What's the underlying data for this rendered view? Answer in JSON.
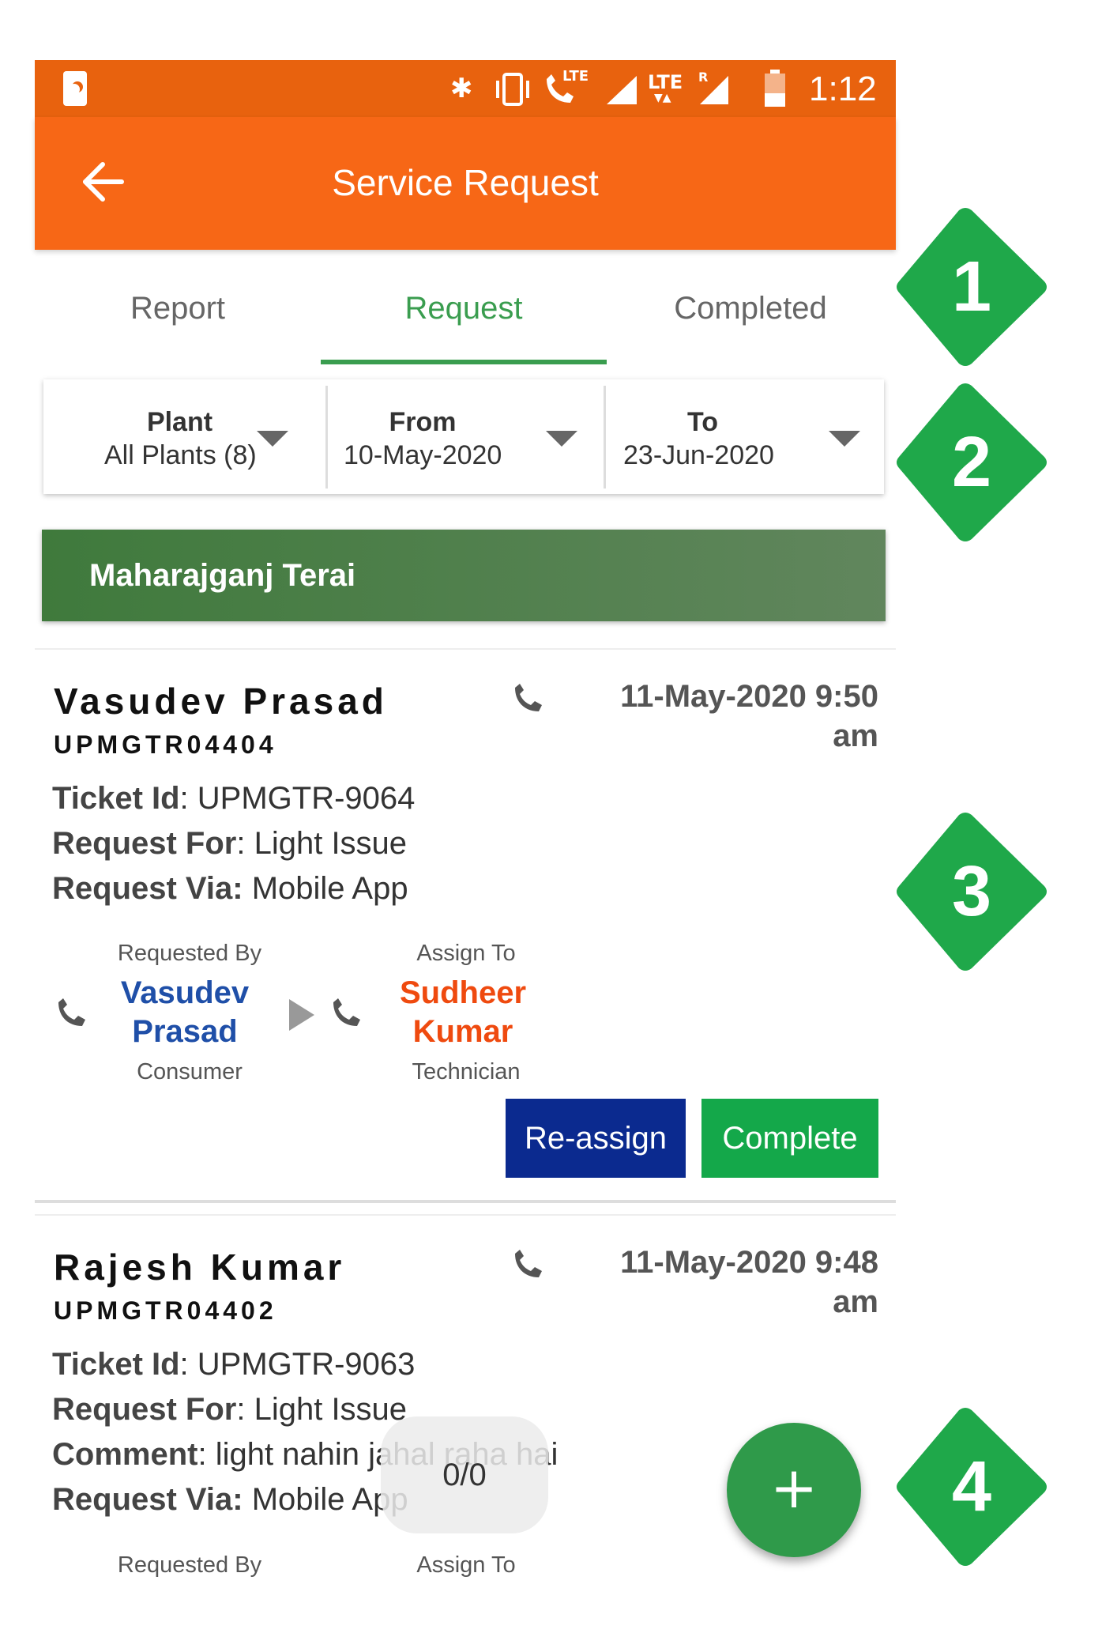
{
  "status_bar": {
    "time": "1:12",
    "icons": [
      "night-mode-icon",
      "bluetooth-icon",
      "vibrate-icon",
      "volte-call-icon",
      "signal-icon",
      "lte-icon",
      "roaming-signal-icon",
      "battery-icon"
    ],
    "lte_label": "LTE",
    "roaming_label": "R"
  },
  "app_bar": {
    "title": "Service Request",
    "back_icon": "arrow-left-icon",
    "color": "#f76716"
  },
  "tabs": [
    {
      "label": "Report",
      "active": false
    },
    {
      "label": "Request",
      "active": true
    },
    {
      "label": "Completed",
      "active": false
    }
  ],
  "filters": {
    "plant": {
      "label": "Plant",
      "value": "All Plants (8)"
    },
    "from": {
      "label": "From",
      "value": "10-May-2020"
    },
    "to": {
      "label": "To",
      "value": "23-Jun-2020"
    }
  },
  "plant_header": "Maharajganj Terai",
  "cards": [
    {
      "name": "Vasudev Prasad",
      "code": "UPMGTR04404",
      "date_line1": "11-May-2020 9:50",
      "date_line2": "am",
      "ticket_label": "Ticket Id",
      "ticket": "UPMGTR-9064",
      "request_for_label": "Request For",
      "request_for": "Light Issue",
      "via_label": "Request Via:",
      "via": "Mobile App",
      "requested_by_label": "Requested By",
      "requested_by_first": "Vasudev",
      "requested_by_last": "Prasad",
      "requested_by_role": "Consumer",
      "assign_to_label": "Assign To",
      "assign_to_first": "Sudheer",
      "assign_to_last": "Kumar",
      "assign_to_role": "Technician",
      "reassign_label": "Re-assign",
      "complete_label": "Complete"
    },
    {
      "name": "Rajesh Kumar",
      "code": "UPMGTR04402",
      "date_line1": "11-May-2020 9:48",
      "date_line2": "am",
      "ticket_label": "Ticket Id",
      "ticket": "UPMGTR-9063",
      "request_for_label": "Request For",
      "request_for": "Light Issue",
      "comment_label": "Comment",
      "comment": "light nahin jahal raha hai",
      "via_label": "Request Via:",
      "via": "Mobile App",
      "requested_by_label": "Requested By",
      "assign_to_label": "Assign To"
    }
  ],
  "page_counter": "0/0",
  "fab_icon": "plus-icon",
  "markers": [
    "1",
    "2",
    "3",
    "4"
  ],
  "colors": {
    "accent_green": "#3a9d4f",
    "reassign": "#0b2a8f",
    "complete": "#14a84a",
    "requester": "#1f4fa8",
    "assignee": "#ef4a0f",
    "marker": "#1fa84a"
  }
}
